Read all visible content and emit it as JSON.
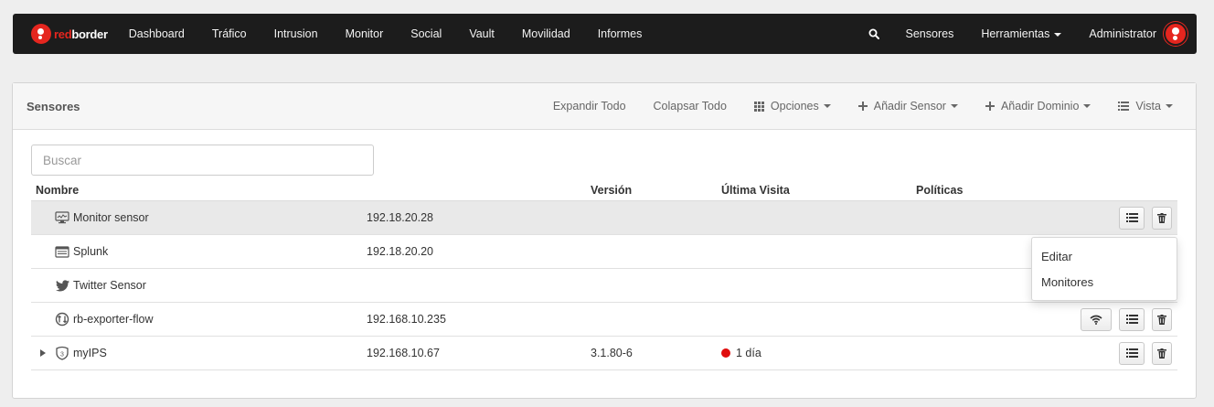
{
  "navbar": {
    "brand_red": "red",
    "brand_white": "border",
    "items": [
      {
        "label": "Dashboard"
      },
      {
        "label": "Tráfico"
      },
      {
        "label": "Intrusion"
      },
      {
        "label": "Monitor"
      },
      {
        "label": "Social"
      },
      {
        "label": "Vault"
      },
      {
        "label": "Movilidad"
      },
      {
        "label": "Informes"
      }
    ],
    "right": {
      "sensores": "Sensores",
      "herramientas": "Herramientas",
      "user": "Administrator"
    },
    "icons": {
      "search": "search-icon",
      "avatar": "redborder-avatar"
    }
  },
  "panel": {
    "title": "Sensores",
    "tools": {
      "expand_all": "Expandir Todo",
      "collapse_all": "Colapsar Todo",
      "options": "Opciones",
      "add_sensor": "Añadir Sensor",
      "add_domain": "Añadir Dominio",
      "view": "Vista"
    }
  },
  "search": {
    "placeholder": "Buscar",
    "value": ""
  },
  "table": {
    "columns": {
      "name": "Nombre",
      "version": "Versión",
      "last_visit": "Última Visita",
      "policies": "Políticas"
    },
    "rows": [
      {
        "name": "Monitor sensor",
        "icon": "monitor-icon",
        "ip": "192.18.20.28",
        "version": "",
        "last_visit": "",
        "policies": "",
        "actions": [
          "list-icon",
          "trash-icon"
        ]
      },
      {
        "name": "Splunk",
        "icon": "server-icon",
        "ip": "192.18.20.20",
        "version": "",
        "last_visit": "",
        "policies": "",
        "actions": []
      },
      {
        "name": "Twitter Sensor",
        "icon": "twitter-icon",
        "ip": "",
        "version": "",
        "last_visit": "",
        "policies": "",
        "actions": []
      },
      {
        "name": "rb-exporter-flow",
        "icon": "flow-icon",
        "ip": "192.168.10.235",
        "version": "",
        "last_visit": "",
        "policies": "",
        "actions": [
          "wifi-icon",
          "list-icon",
          "trash-icon"
        ]
      },
      {
        "name": "myIPS",
        "icon": "ips-icon",
        "ip": "192.168.10.67",
        "version": "3.1.80-6",
        "last_visit": "1 día",
        "status_color": "#e00d0d",
        "policies": "",
        "actions": [
          "list-icon",
          "trash-icon"
        ]
      }
    ]
  },
  "dropdown": {
    "items": [
      {
        "label": "Editar"
      },
      {
        "label": "Monitores"
      }
    ]
  },
  "colors": {
    "navbar_bg": "#1c1c1c",
    "brand_red": "#e5261f",
    "row_highlight": "#e9e9e9"
  }
}
